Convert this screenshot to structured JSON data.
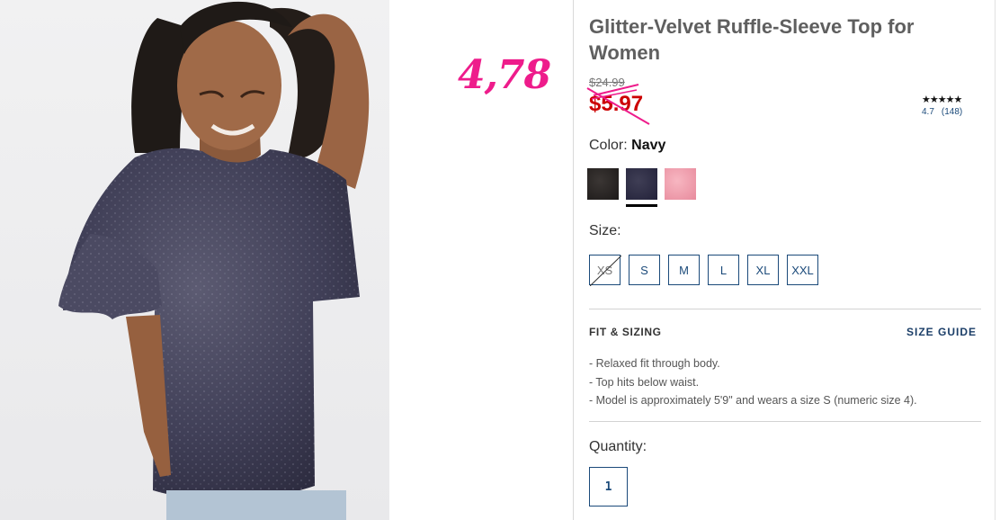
{
  "product": {
    "title": "Glitter-Velvet Ruffle-Sleeve Top for Women",
    "original_price": "$24.99",
    "sale_price": "$5.97",
    "rating": {
      "stars": "★★★★★",
      "value": "4.7",
      "count": "(148)"
    },
    "color_label": "Color:",
    "selected_color": "Navy",
    "swatches": [
      "black-velvet",
      "navy-velvet",
      "pink-velvet"
    ],
    "size_label": "Size:",
    "sizes": [
      {
        "label": "XS",
        "available": false
      },
      {
        "label": "S",
        "available": true
      },
      {
        "label": "M",
        "available": true
      },
      {
        "label": "L",
        "available": true
      },
      {
        "label": "XL",
        "available": true
      },
      {
        "label": "XXL",
        "available": true
      }
    ],
    "fit_heading": "FIT & SIZING",
    "size_guide": "SIZE GUIDE",
    "fit_bullets": [
      "Relaxed fit through body.",
      "Top hits below waist.",
      "Model is approximately 5'9\" and wears a size S (numeric size 4)."
    ],
    "quantity_label": "Quantity:",
    "quantity_value": "1"
  },
  "annotation": {
    "handwritten_price": "4,78"
  },
  "colors": {
    "sale_red": "#cc0000",
    "link_navy": "#1b4a7a",
    "annotation_pink": "#ee1c8b"
  }
}
